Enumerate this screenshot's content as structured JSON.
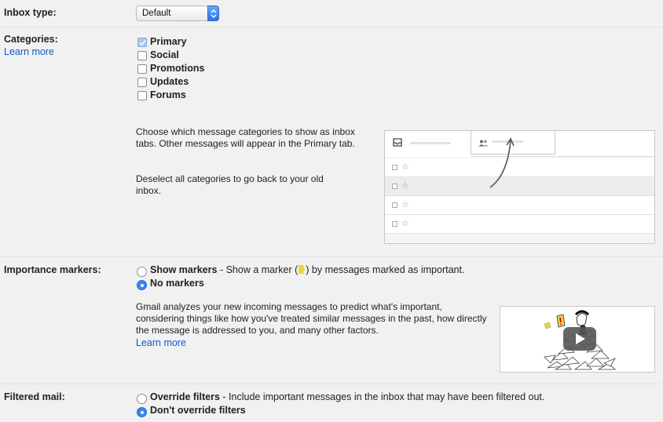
{
  "inbox_type": {
    "label": "Inbox type:",
    "selected": "Default"
  },
  "categories": {
    "label": "Categories:",
    "learn_more": "Learn more",
    "items": [
      {
        "label": "Primary",
        "checked": true
      },
      {
        "label": "Social",
        "checked": false
      },
      {
        "label": "Promotions",
        "checked": false
      },
      {
        "label": "Updates",
        "checked": false
      },
      {
        "label": "Forums",
        "checked": false
      }
    ],
    "description_1": "Choose which message categories to show as inbox tabs. Other messages will appear in the Primary tab.",
    "description_2": "Deselect all categories to go back to your old inbox.",
    "preview_icons": [
      "inbox-icon",
      "people-icon",
      "arrow-icon",
      "star-icon"
    ]
  },
  "importance_markers": {
    "label": "Importance markers:",
    "options": [
      {
        "title": "Show markers",
        "rest_before": " - Show a marker (",
        "rest_after": ") by messages marked as important.",
        "selected": false
      },
      {
        "title": "No markers",
        "selected": true
      }
    ],
    "description": "Gmail analyzes your new incoming messages to predict what's important, considering things like how you've treated similar messages in the past, how directly the message is addressed to you, and many other factors.",
    "learn_more": "Learn more",
    "marker_color": "#f2d23a",
    "video_icons": [
      "play-icon"
    ]
  },
  "filtered_mail": {
    "label": "Filtered mail:",
    "options": [
      {
        "title": "Override filters",
        "rest": " - Include important messages in the inbox that may have been filtered out.",
        "selected": false
      },
      {
        "title": "Don't override filters",
        "rest": "",
        "selected": true
      }
    ]
  }
}
